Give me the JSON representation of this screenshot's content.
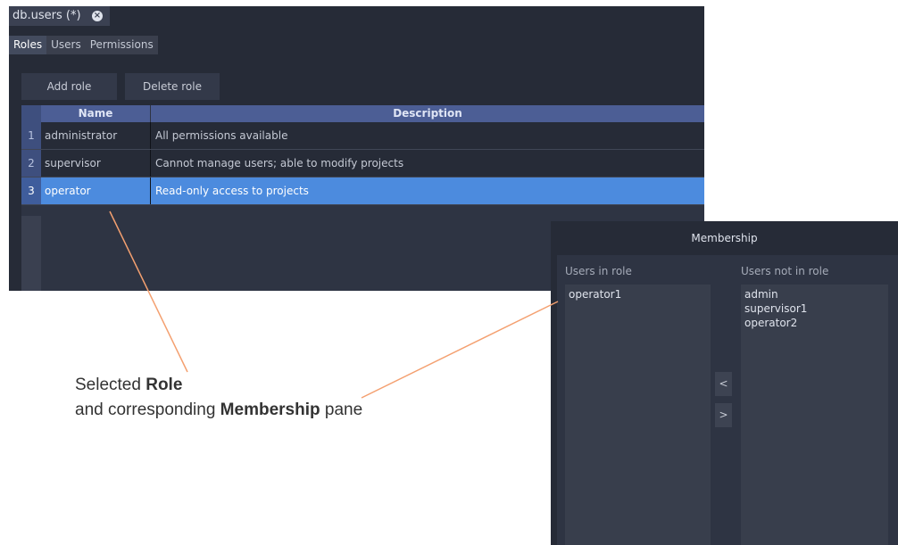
{
  "window": {
    "doc_tab": "db.users (*)",
    "close_glyph": "×",
    "tabs": [
      {
        "label": "Roles",
        "active": true
      },
      {
        "label": "Users",
        "active": false
      },
      {
        "label": "Permissions",
        "active": false
      }
    ],
    "toolbar": {
      "add_role": "Add role",
      "delete_role": "Delete role"
    },
    "grid": {
      "headers": {
        "name": "Name",
        "description": "Description"
      },
      "rows": [
        {
          "num": "1",
          "name": "administrator",
          "description": "All permissions available"
        },
        {
          "num": "2",
          "name": "supervisor",
          "description": "Cannot manage users; able to modify projects"
        },
        {
          "num": "3",
          "name": "operator",
          "description": "Read-only access to projects",
          "selected": true
        }
      ]
    }
  },
  "membership": {
    "title": "Membership",
    "in_role_label": "Users in role",
    "not_in_role_label": "Users not in role",
    "in_role": [
      "operator1"
    ],
    "not_in_role": [
      "admin",
      "supervisor1",
      "operator2"
    ],
    "move_left": "<",
    "move_right": ">"
  },
  "caption": {
    "line1_prefix": "Selected ",
    "line1_bold": "Role",
    "line2_prefix": "and corresponding ",
    "line2_bold": "Membership",
    "line2_suffix": " pane"
  },
  "colors": {
    "selection": "#4c8bde",
    "header": "#4c5e95",
    "callout": "#f4a070"
  }
}
